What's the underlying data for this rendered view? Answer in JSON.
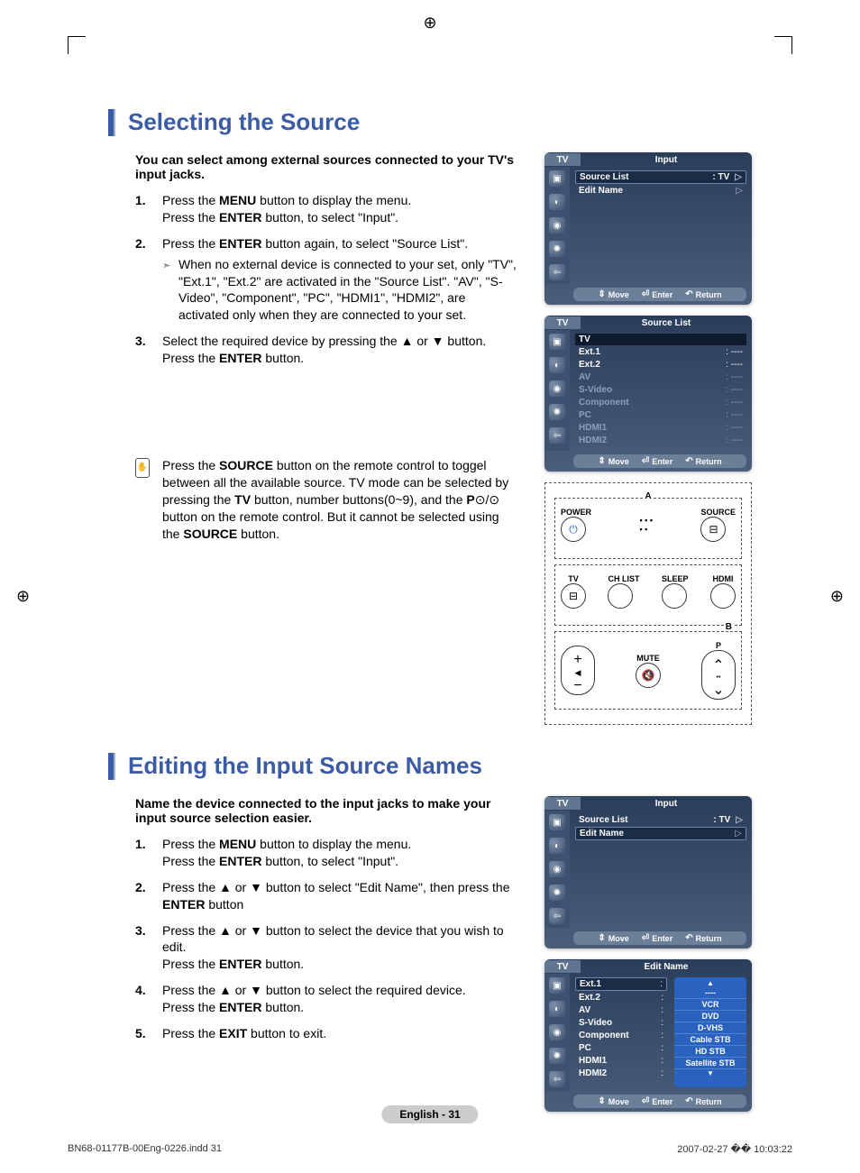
{
  "page": {
    "section1": {
      "title": "Selecting the Source",
      "intro": "You can select among external sources connected to your TV's input jacks.",
      "steps": [
        {
          "num": "1.",
          "lines": "Press the MENU button to display the menu.\nPress the ENTER button, to select \"Input\"."
        },
        {
          "num": "2.",
          "lines": "Press the ENTER button again, to select \"Source List\".",
          "note": "When no external device is connected to your set, only \"TV\", \"Ext.1\", \"Ext.2\" are activated in the \"Source List\". \"AV\", \"S-Video\", \"Component\", \"PC\", \"HDMI1\", \"HDMI2\", are activated only when they are connected to your set."
        },
        {
          "num": "3.",
          "lines": "Select the required device by pressing the ▲ or ▼ button.\nPress the ENTER button."
        }
      ],
      "remote_note": "Press the SOURCE button on the remote control to toggel between all the available source. TV mode can be selected by pressing the TV button, number buttons(0~9), and the P⊙/⊙ button on the remote control. But it cannot be selected using the SOURCE button."
    },
    "osd_input": {
      "tab": "TV",
      "title": "Input",
      "rows": [
        {
          "label": "Source List",
          "value": ": TV",
          "hl": true
        },
        {
          "label": "Edit Name",
          "value": ""
        }
      ],
      "footer": {
        "move": "Move",
        "enter": "Enter",
        "return": "Return"
      }
    },
    "osd_sourcelist": {
      "tab": "TV",
      "title": "Source List",
      "rows": [
        {
          "label": "TV",
          "value": "",
          "hl": true
        },
        {
          "label": "Ext.1",
          "value": ": ----"
        },
        {
          "label": "Ext.2",
          "value": ": ----"
        },
        {
          "label": "AV",
          "value": ": ----",
          "dim": true
        },
        {
          "label": "S-Video",
          "value": ": ----",
          "dim": true
        },
        {
          "label": "Component",
          "value": ": ----",
          "dim": true
        },
        {
          "label": "PC",
          "value": ": ----",
          "dim": true
        },
        {
          "label": "HDMI1",
          "value": ": ----",
          "dim": true
        },
        {
          "label": "HDMI2",
          "value": ": ----",
          "dim": true
        }
      ],
      "footer": {
        "move": "Move",
        "enter": "Enter",
        "return": "Return"
      }
    },
    "remote": {
      "callout_a": "A",
      "callout_b": "B",
      "power": "POWER",
      "source": "SOURCE",
      "tv": "TV",
      "chlist": "CH LIST",
      "sleep": "SLEEP",
      "hdmi": "HDMI",
      "p": "P",
      "mute": "MUTE"
    },
    "section2": {
      "title": "Editing the Input Source Names",
      "intro": "Name the device connected to the input jacks to make your input source selection easier.",
      "steps": [
        {
          "num": "1.",
          "lines": "Press the MENU button to display the menu.\nPress the ENTER button, to select \"Input\"."
        },
        {
          "num": "2.",
          "lines": "Press the ▲ or ▼ button to select \"Edit Name\", then press the ENTER button"
        },
        {
          "num": "3.",
          "lines": "Press the ▲ or ▼ button to select the device that you wish to edit.\nPress the ENTER button."
        },
        {
          "num": "4.",
          "lines": "Press the ▲ or ▼ button to select the required device.\nPress the ENTER button."
        },
        {
          "num": "5.",
          "lines": "Press the EXIT button to exit."
        }
      ]
    },
    "osd_input2": {
      "tab": "TV",
      "title": "Input",
      "rows": [
        {
          "label": "Source List",
          "value": ": TV"
        },
        {
          "label": "Edit Name",
          "value": "",
          "hl": true
        }
      ],
      "footer": {
        "move": "Move",
        "enter": "Enter",
        "return": "Return"
      }
    },
    "osd_editname": {
      "tab": "TV",
      "title": "Edit Name",
      "rows": [
        {
          "label": "Ext.1",
          "value": ":",
          "hl": true
        },
        {
          "label": "Ext.2",
          "value": ":"
        },
        {
          "label": "AV",
          "value": ":"
        },
        {
          "label": "S-Video",
          "value": ":"
        },
        {
          "label": "Component",
          "value": ":"
        },
        {
          "label": "PC",
          "value": ":"
        },
        {
          "label": "HDMI1",
          "value": ":"
        },
        {
          "label": "HDMI2",
          "value": ":"
        }
      ],
      "options": [
        "----",
        "VCR",
        "DVD",
        "D-VHS",
        "Cable STB",
        "HD STB",
        "Satellite STB"
      ],
      "footer": {
        "move": "Move",
        "enter": "Enter",
        "return": "Return"
      }
    },
    "page_num": "English - 31",
    "doc_footer_left": "BN68-01177B-00Eng-0226.indd   31",
    "doc_footer_right": "2007-02-27   �� 10:03:22"
  }
}
